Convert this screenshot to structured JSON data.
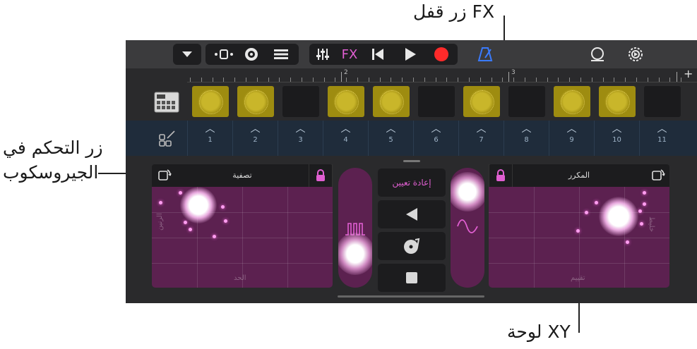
{
  "callouts": {
    "fx_lock": "زر قفل FX",
    "gyro_line1": "زر التحكم في",
    "gyro_line2": "الجيروسكوب",
    "xy_pad": "لوحة XY"
  },
  "toolbar": {
    "fx_label": "FX",
    "record_color": "#ff2a2a",
    "fx_color": "#e15fd2",
    "metronome_color": "#3a7bff",
    "icons": [
      "chevron-down-icon",
      "tracks-view-icon",
      "live-loops-icon",
      "mixer-icon",
      "sliders-icon",
      "rewind-icon",
      "play-icon",
      "record-icon",
      "metronome-icon",
      "loop-icon",
      "settings-icon"
    ]
  },
  "ruler": {
    "markers": [
      "2",
      "3"
    ],
    "add_label": "+"
  },
  "grid": {
    "active_cells": [
      true,
      true,
      false,
      true,
      true,
      false,
      true,
      false,
      true,
      true,
      false
    ],
    "triggers": [
      "1",
      "2",
      "3",
      "4",
      "5",
      "6",
      "7",
      "8",
      "9",
      "10",
      "11"
    ],
    "cell_color": "#9e8c10",
    "trigger_row_color": "#1f2c3b"
  },
  "fx": {
    "left_pad": {
      "title": "تصفية",
      "y_label": "الرنين",
      "x_label": "الحد"
    },
    "right_pad": {
      "title": "المكرر",
      "y_label": "خليط",
      "x_label": "تقييم"
    },
    "reset_label": "إعادة تعيين",
    "accent_color": "#e15fd2",
    "pad_color": "#5c2150"
  }
}
